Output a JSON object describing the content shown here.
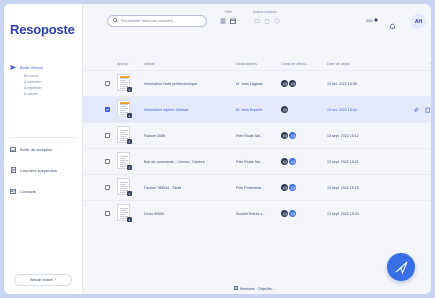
{
  "app": {
    "name": "Resoposte"
  },
  "sidebar": {
    "inbox_label": "Boîte d'envoi",
    "inbox_sub": [
      "En cours",
      "À contrôler",
      "À imprimer",
      "À valider"
    ],
    "items": [
      {
        "label": "Boîte de réception",
        "icon": "inbox-icon"
      },
      {
        "label": "Courriers suspendus",
        "icon": "document-icon"
      },
      {
        "label": "Contacts",
        "icon": "contacts-icon"
      }
    ],
    "help_label": "Besoin d'aide ?"
  },
  "header": {
    "search_placeholder": "Rechercher dans vos courriers...",
    "filter_label": "Filtre",
    "bulk_label": "Actions multiples",
    "quota": "200",
    "avatar_initials": "AH"
  },
  "table": {
    "columns": [
      "Aperçu",
      "Intitulé",
      "Destinataires",
      "Canal de diffusi...",
      "Date de dépôt"
    ],
    "rows": [
      {
        "title": "Information l'acte préélectronique",
        "recipient": "M. Jean Lagarde",
        "date": "13 oct. 2022 15:35",
        "chips": [
          "dark",
          "dark"
        ],
        "selected": false,
        "badge": "2",
        "color_thumb": true
      },
      {
        "title": "Information repérer Adresse",
        "recipient": "M. Jean Expédit",
        "date": "13 oct. 2022 15:44",
        "chips": [
          "dark"
        ],
        "selected": true,
        "badge": "2",
        "color_thumb": true
      },
      {
        "title": "Facture 3085",
        "recipient": "Pôle Étude Sal...",
        "date": "13 sept. 2022 15:12",
        "chips": [
          "dark",
          "blue"
        ],
        "selected": false,
        "badge": "1",
        "color_thumb": false
      },
      {
        "title": "Bon de commande - Cerviot - Octobre",
        "recipient": "Pôle Étude Sal...",
        "date": "13 sept. 2022 15:21",
        "chips": [
          "dark",
          "blue"
        ],
        "selected": false,
        "badge": "1",
        "color_thumb": false
      },
      {
        "title": "Facture 785044 - S&dit",
        "recipient": "Pôle Partenaria...",
        "date": "13 sept. 2022 15:15",
        "chips": [
          "dark",
          "blue"
        ],
        "selected": false,
        "badge": "1",
        "color_thumb": false
      },
      {
        "title": "Devis 00050",
        "recipient": "Société Entrée s...",
        "date": "13 sept. 2022 15:34",
        "chips": [
          "dark",
          "blue"
        ],
        "selected": false,
        "badge": "1",
        "color_thumb": false
      }
    ]
  },
  "footer": {
    "label": "Mentions · Objectifs..."
  },
  "colors": {
    "brand": "#2a3eb1",
    "accent": "#3a5ad9",
    "fab": "#3a6ee8",
    "selected_row": "#e3e8fb"
  }
}
